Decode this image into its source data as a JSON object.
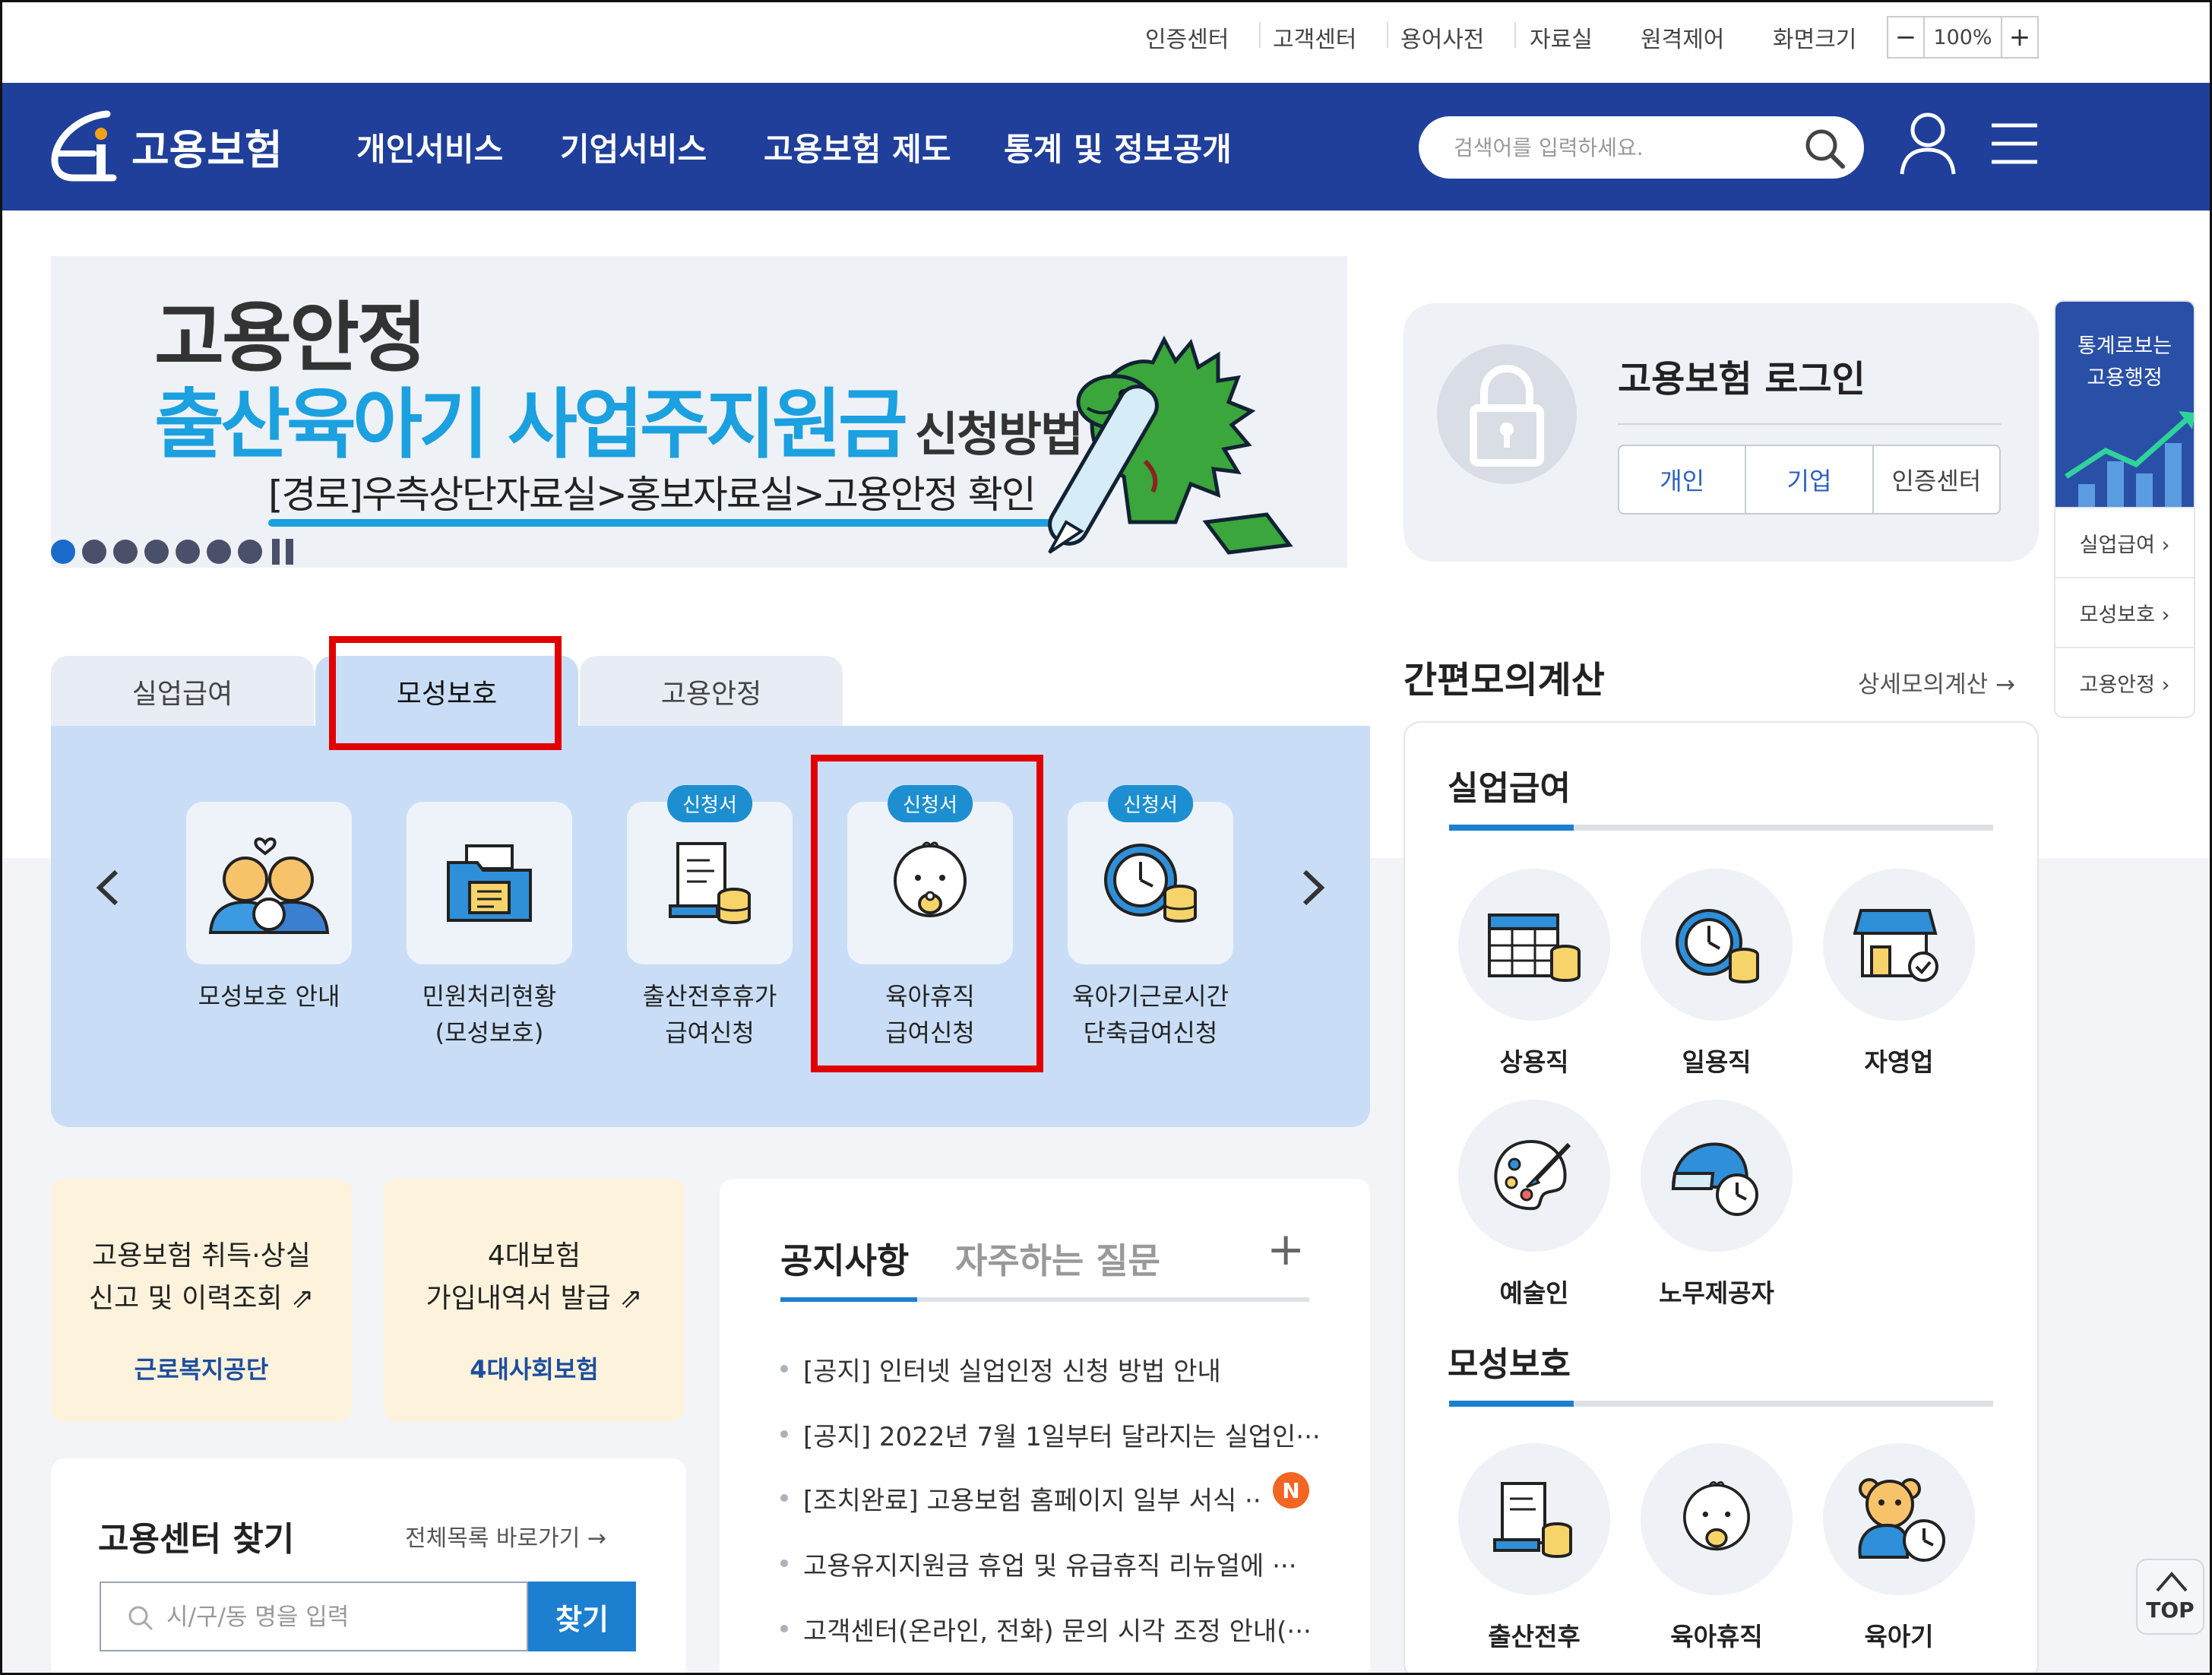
{
  "util_links": [
    "인증센터",
    "고객센터",
    "용어사전",
    "자료실",
    "원격제어",
    "화면크기"
  ],
  "zoom": {
    "minus": "−",
    "value": "100%",
    "plus": "+"
  },
  "header": {
    "logo_text": "고용보험",
    "nav": [
      "개인서비스",
      "기업서비스",
      "고용보험 제도",
      "통계 및 정보공개"
    ],
    "search_placeholder": "검색어를 입력하세요."
  },
  "banner": {
    "line1": "고용안정",
    "line2_big": "출산육아기 사업주지원금",
    "line2_small": "신청방법",
    "line3": "[경로]우측상단자료실>홍보자료실>고용안정 확인",
    "slide_count": 7,
    "active_slide": 1
  },
  "login": {
    "title": "고용보험 로그인",
    "buttons": [
      "개인",
      "기업",
      "인증센터"
    ]
  },
  "quick_menu": {
    "title_line1": "통계로보는",
    "title_line2": "고용행정",
    "items": [
      "실업급여 ›",
      "모성보호 ›",
      "고용안정 ›"
    ]
  },
  "service_tabs": {
    "tabs": [
      "실업급여",
      "모성보호",
      "고용안정"
    ],
    "active": "모성보호",
    "items": [
      {
        "line1": "모성보호 안내",
        "line2": "",
        "badge": ""
      },
      {
        "line1": "민원처리현황",
        "line2": "(모성보호)",
        "badge": ""
      },
      {
        "line1": "출산전후휴가",
        "line2": "급여신청",
        "badge": "신청서"
      },
      {
        "line1": "육아휴직",
        "line2": "급여신청",
        "badge": "신청서"
      },
      {
        "line1": "육아기근로시간",
        "line2": "단축급여신청",
        "badge": "신청서"
      }
    ]
  },
  "quick_cards": [
    {
      "line1": "고용보험 취득·상실",
      "line2": "신고 및 이력조회 ⇗",
      "org": "근로복지공단"
    },
    {
      "line1": "4대보험",
      "line2": "가입내역서 발급 ⇗",
      "org": "4대사회보험"
    }
  ],
  "finder": {
    "title": "고용센터 찾기",
    "link": "전체목록 바로가기 →",
    "placeholder": "시/구/동 명을 입력",
    "button": "찾기"
  },
  "notice": {
    "tab_active": "공지사항",
    "tab_inactive": "자주하는 질문",
    "plus": "+",
    "badge": "N",
    "items": [
      "[공지] 인터넷 실업인정 신청 방법 안내",
      "[공지] 2022년 7월 1일부터 달라지는 실업인···",
      "[조치완료] 고용보험 홈페이지 일부 서식 ···",
      "고용유지지원금 휴업 및 유급휴직 리뉴얼에 ···",
      "고객센터(온라인, 전화) 문의 시각 조정 안내(···"
    ]
  },
  "calculator": {
    "title": "간편모의계산",
    "link": "상세모의계산 →",
    "section1": "실업급여",
    "section1_items": [
      "상용직",
      "일용직",
      "자영업",
      "예술인",
      "노무제공자"
    ],
    "section2": "모성보호",
    "section2_items": [
      "출산전후",
      "육아휴직",
      "육아기"
    ]
  },
  "top_button": "TOP",
  "colors": {
    "header": "#1f3f9b",
    "accent": "#1ba0e0",
    "highlight": "#e20000",
    "panel": "#c9def6"
  }
}
